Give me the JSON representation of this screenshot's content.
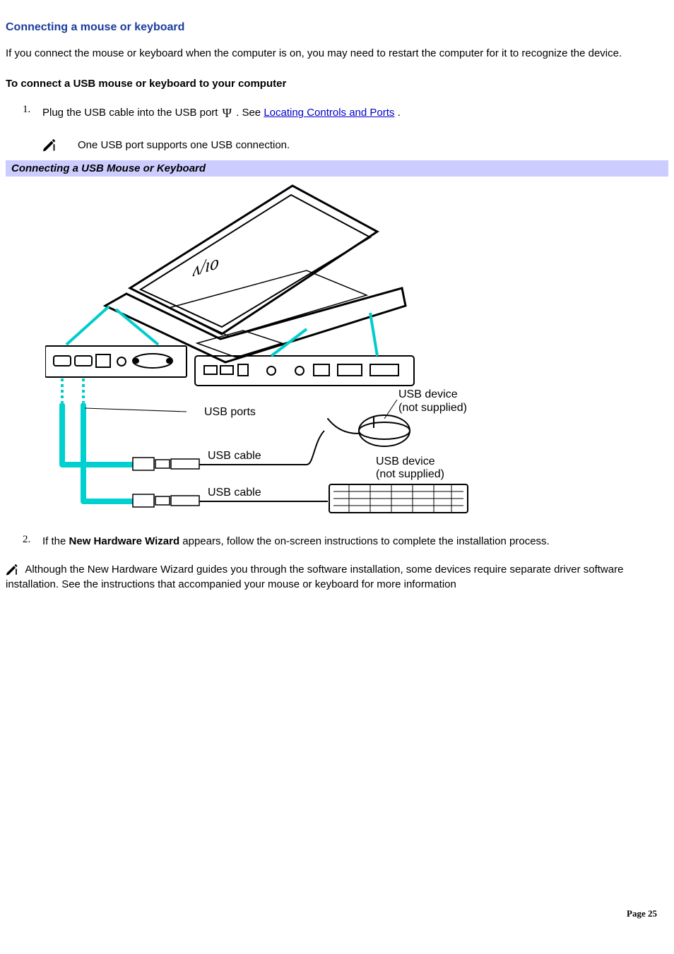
{
  "heading": "Connecting a mouse or keyboard",
  "intro": "If you connect the mouse or keyboard when the computer is on, you may need to restart the computer for it to recognize the device.",
  "sub_heading": "To connect a USB mouse or keyboard to your computer",
  "steps": {
    "one_prefix": "Plug the USB cable into the USB port ",
    "one_suffix": ". See ",
    "one_link": "Locating Controls and Ports",
    "one_period": ".",
    "note1": "One USB port supports one USB connection.",
    "two_prefix": "If the ",
    "two_bold": "New Hardware Wizard",
    "two_suffix": " appears, follow the on-screen instructions to complete the installation process."
  },
  "figure": {
    "title": "Connecting a USB Mouse or Keyboard",
    "labels": {
      "usb_ports": "USB ports",
      "usb_cable1": "USB cable",
      "usb_cable2": "USB cable",
      "usb_device1a": "USB device",
      "usb_device1b": "(not supplied)",
      "usb_device2a": "USB device",
      "usb_device2b": "(not supplied)"
    }
  },
  "post_note": " Although the New Hardware Wizard guides you through the software installation, some devices require separate driver software installation. See the instructions that accompanied your mouse or keyboard for more information",
  "footer": "Page 25"
}
